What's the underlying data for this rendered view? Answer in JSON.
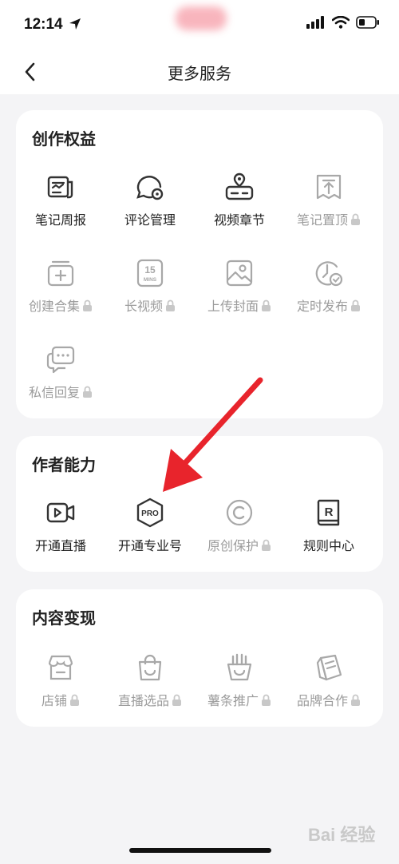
{
  "status_bar": {
    "time": "12:14"
  },
  "nav": {
    "title": "更多服务"
  },
  "sections": {
    "creation": {
      "title": "创作权益",
      "items": [
        {
          "label": "笔记周报",
          "icon": "weekly-report-icon",
          "locked": false
        },
        {
          "label": "评论管理",
          "icon": "comment-manage-icon",
          "locked": false
        },
        {
          "label": "视频章节",
          "icon": "video-chapter-icon",
          "locked": false
        },
        {
          "label": "笔记置顶",
          "icon": "pin-top-icon",
          "locked": true
        },
        {
          "label": "创建合集",
          "icon": "create-collection-icon",
          "locked": true
        },
        {
          "label": "长视频",
          "icon": "long-video-icon",
          "locked": true
        },
        {
          "label": "上传封面",
          "icon": "upload-cover-icon",
          "locked": true
        },
        {
          "label": "定时发布",
          "icon": "scheduled-publish-icon",
          "locked": true
        },
        {
          "label": "私信回复",
          "icon": "message-reply-icon",
          "locked": true
        }
      ]
    },
    "ability": {
      "title": "作者能力",
      "items": [
        {
          "label": "开通直播",
          "icon": "live-video-icon",
          "locked": false
        },
        {
          "label": "开通专业号",
          "icon": "pro-badge-icon",
          "locked": false
        },
        {
          "label": "原创保护",
          "icon": "copyright-icon",
          "locked": true
        },
        {
          "label": "规则中心",
          "icon": "rules-book-icon",
          "locked": false
        }
      ]
    },
    "monetize": {
      "title": "内容变现",
      "items": [
        {
          "label": "店铺",
          "icon": "shop-icon",
          "locked": true
        },
        {
          "label": "直播选品",
          "icon": "shopping-bag-icon",
          "locked": true
        },
        {
          "label": "薯条推广",
          "icon": "fries-icon",
          "locked": true
        },
        {
          "label": "品牌合作",
          "icon": "brand-coop-icon",
          "locked": true
        }
      ]
    }
  },
  "icon_text": {
    "long_video_top": "15",
    "long_video_bottom": "MINS",
    "pro": "PRO",
    "rules": "R"
  },
  "watermark": "Bai 经验",
  "colors": {
    "annotation_arrow": "#e8242c",
    "locked_text": "#9c9c9c"
  }
}
